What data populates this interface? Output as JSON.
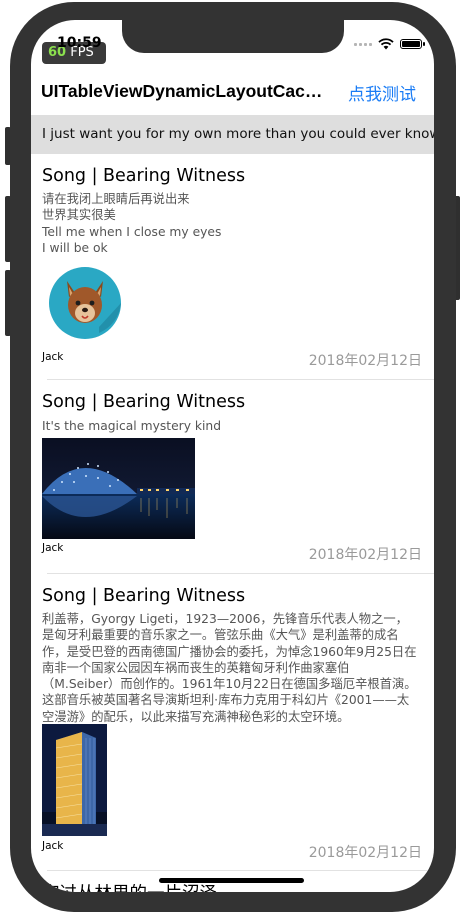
{
  "status_bar": {
    "time": "10:59",
    "fps_value": "60",
    "fps_label": " FPS"
  },
  "nav": {
    "title": "UITableViewDynamicLayoutCacheHeight",
    "action": "点我测试"
  },
  "header": {
    "text": "I just want you for my own more than you could ever know"
  },
  "cells": [
    {
      "title": "Song | Bearing Witness",
      "body": "请在我闭上眼睛后再说出来\n世界其实很美\nTell me when I close my eyes\nI will be ok",
      "author": "Jack",
      "date": "2018年02月12日",
      "image": "fox-avatar"
    },
    {
      "title": "Song | Bearing Witness",
      "body": "It's the magical mystery kind",
      "author": "Jack",
      "date": "2018年02月12日",
      "image": "night-dome-building-photo"
    },
    {
      "title": "Song | Bearing Witness",
      "body": "利盖蒂，Gyorgy Ligeti，1923—2006，先锋音乐代表人物之一，是匈牙利最重要的音乐家之一。管弦乐曲《大气》是利盖蒂的成名作，是受巴登的西南德国广播协会的委托，为悼念1960年9月25日在南非一个国家公园因车祸而丧生的英籍匈牙利作曲家塞伯（M.Seiber）而创作的。1961年10月22日在德国多瑙厄辛根首演。这部音乐被英国著名导演斯坦利·库布力克用于科幻片《2001——太空漫游》的配乐，以此来描写充满神秘色彩的太空环境。",
      "author": "Jack",
      "date": "2018年02月12日",
      "image": "night-tower-photo"
    }
  ],
  "next_cell_title": "穿过丛林里的一片沼泽"
}
